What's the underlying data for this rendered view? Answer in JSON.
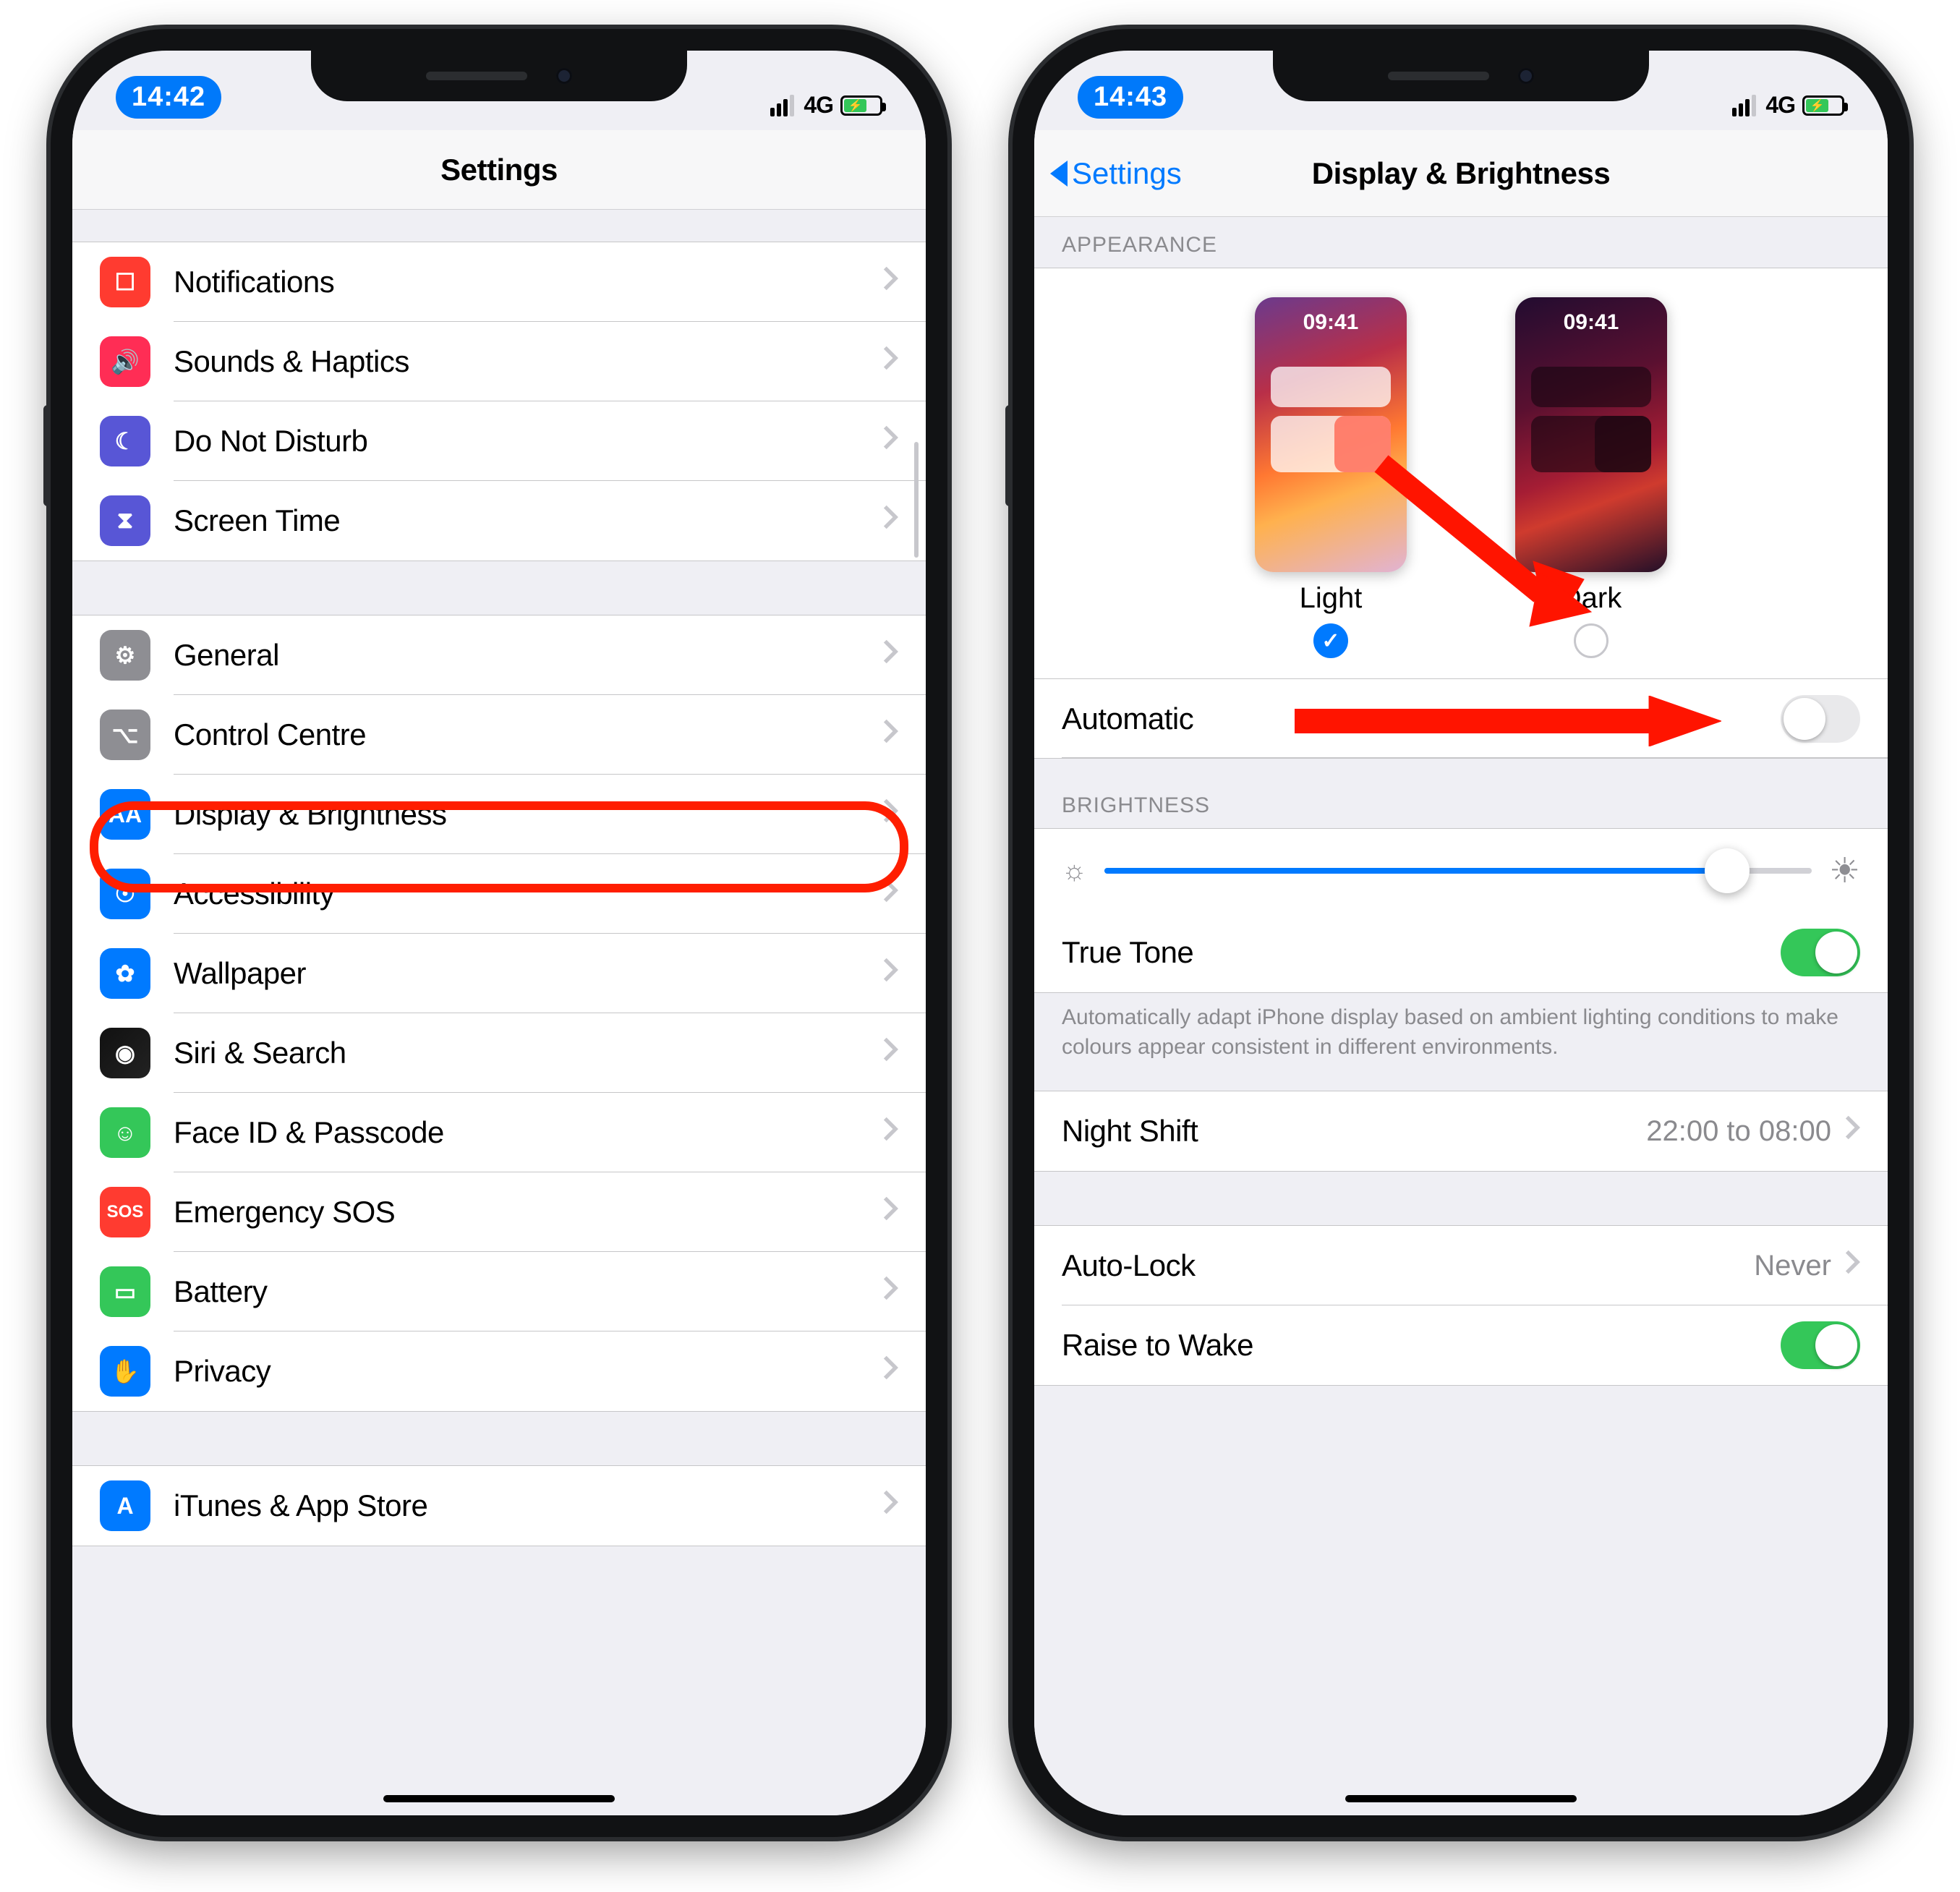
{
  "left": {
    "status": {
      "time": "14:42",
      "network": "4G"
    },
    "nav": {
      "title": "Settings"
    },
    "rows": [
      {
        "icon": "notifications-icon",
        "bg": "ic-red",
        "glyph": "☐",
        "label": "Notifications"
      },
      {
        "icon": "sounds-icon",
        "bg": "ic-pink",
        "glyph": "🔊",
        "label": "Sounds & Haptics"
      },
      {
        "icon": "dnd-icon",
        "bg": "ic-purple",
        "glyph": "☾",
        "label": "Do Not Disturb"
      },
      {
        "icon": "screentime-icon",
        "bg": "ic-purple",
        "glyph": "⧗",
        "label": "Screen Time"
      }
    ],
    "rows2": [
      {
        "icon": "gear-icon",
        "bg": "ic-gray",
        "glyph": "⚙",
        "label": "General"
      },
      {
        "icon": "control-centre-icon",
        "bg": "ic-gray",
        "glyph": "⌥",
        "label": "Control Centre"
      },
      {
        "icon": "display-icon",
        "bg": "ic-blue",
        "glyph": "AA",
        "label": "Display & Brightness"
      },
      {
        "icon": "accessibility-icon",
        "bg": "ic-blue",
        "glyph": "☉",
        "label": "Accessibility"
      },
      {
        "icon": "wallpaper-icon",
        "bg": "ic-blue",
        "glyph": "✿",
        "label": "Wallpaper"
      },
      {
        "icon": "siri-icon",
        "bg": "ic-siri",
        "glyph": "◉",
        "label": "Siri & Search"
      },
      {
        "icon": "faceid-icon",
        "bg": "ic-green",
        "glyph": "☺",
        "label": "Face ID & Passcode"
      },
      {
        "icon": "sos-icon",
        "bg": "ic-red2",
        "glyph": "SOS",
        "label": "Emergency SOS"
      },
      {
        "icon": "battery-icon",
        "bg": "ic-green",
        "glyph": "▭",
        "label": "Battery"
      },
      {
        "icon": "privacy-icon",
        "bg": "ic-blue",
        "glyph": "✋",
        "label": "Privacy"
      }
    ],
    "rows3": [
      {
        "icon": "appstore-icon",
        "bg": "ic-blue",
        "glyph": "A",
        "label": "iTunes & App Store"
      }
    ]
  },
  "right": {
    "status": {
      "time": "14:43",
      "network": "4G"
    },
    "nav": {
      "back": "Settings",
      "title": "Display & Brightness"
    },
    "sections": {
      "appearance_header": "APPEARANCE",
      "brightness_header": "BRIGHTNESS"
    },
    "appearance": {
      "light_label": "Light",
      "dark_label": "Dark",
      "preview_time": "09:41",
      "selected": "light",
      "automatic_label": "Automatic",
      "automatic_on": false
    },
    "brightness": {
      "value_percent": 88,
      "true_tone_label": "True Tone",
      "true_tone_on": true,
      "true_tone_footer": "Automatically adapt iPhone display based on ambient lighting conditions to make colours appear consistent in different environments."
    },
    "night_shift": {
      "label": "Night Shift",
      "detail": "22:00 to 08:00"
    },
    "auto_lock": {
      "label": "Auto-Lock",
      "detail": "Never"
    },
    "raise_to_wake": {
      "label": "Raise to Wake",
      "on": true
    }
  }
}
